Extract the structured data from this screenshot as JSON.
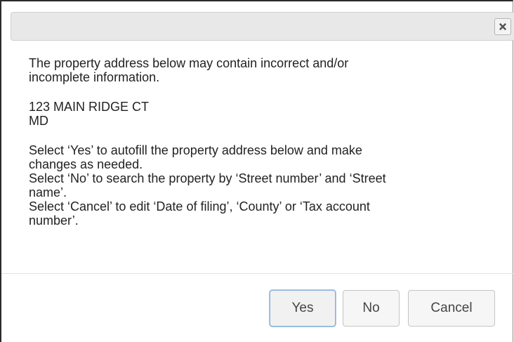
{
  "dialog": {
    "close_label": "close",
    "message": {
      "line1": "The property address below may contain incorrect and/or",
      "line2": "incomplete information.",
      "address_line1": "123 MAIN RIDGE CT",
      "address_line2": "MD",
      "instruction1_a": "Select ‘Yes’ to autofill the property address below and make",
      "instruction1_b": "changes as needed.",
      "instruction2_a": "Select ‘No’ to search the property by ‘Street number’ and ‘Street",
      "instruction2_b": "name’.",
      "instruction3_a": "Select ‘Cancel’ to edit ‘Date of filing’, ‘County’ or ‘Tax account",
      "instruction3_b": "number’."
    },
    "buttons": {
      "yes": "Yes",
      "no": "No",
      "cancel": "Cancel"
    }
  },
  "colors": {
    "titlebar_bg": "#e8e8e8",
    "button_bg": "#f6f6f6",
    "focus_border": "#8eb3da",
    "text": "#222222"
  },
  "icons": {
    "close": "close-icon"
  }
}
